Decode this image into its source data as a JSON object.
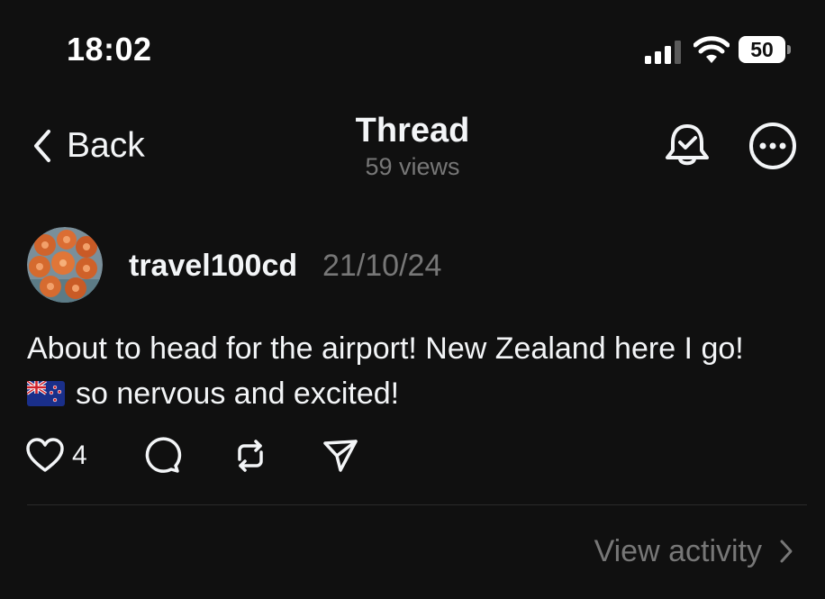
{
  "status_bar": {
    "time": "18:02",
    "battery_level": "50"
  },
  "header": {
    "back_label": "Back",
    "title": "Thread",
    "views": "59 views",
    "icons": {
      "back": "chevron-left-icon",
      "notify": "bell-check-icon",
      "more": "more-horizontal-circle-icon"
    }
  },
  "post": {
    "author": "travel100cd",
    "date": "21/10/24",
    "text_line1": "About to head for the airport! New Zealand here I go!",
    "text_line2": "so nervous and excited!",
    "flag": "new-zealand-flag-emoji",
    "like_count": "4",
    "actions": [
      "heart-icon",
      "comment-icon",
      "repost-icon",
      "share-icon"
    ]
  },
  "footer": {
    "view_activity": "View activity"
  },
  "colors": {
    "background": "#101010",
    "text_primary": "#f3f5f7",
    "text_secondary": "#777777",
    "divider": "#2a2a2a"
  }
}
